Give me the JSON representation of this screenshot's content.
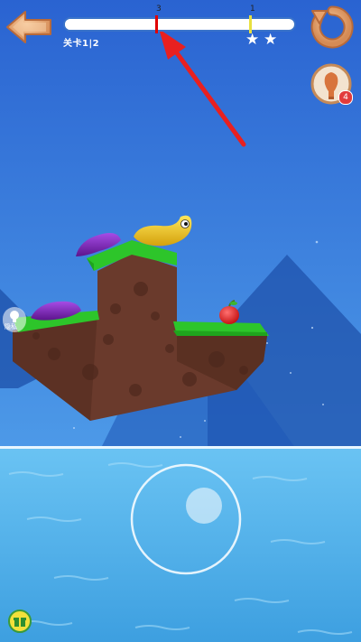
{
  "hud": {
    "back_button_icon": "left-arrow-icon",
    "restart_button_icon": "restart-icon",
    "progress": {
      "fraction": 0.4,
      "marker_three_stars_label": "3",
      "marker_one_star_label": "1",
      "marker_three_stars_color": "#e00000",
      "marker_one_star_color": "#e8e040"
    },
    "level_label": "关卡1|2",
    "stars": [
      "★",
      "★"
    ],
    "hint": {
      "icon": "lightbulb-hint-icon",
      "badge_count": "4",
      "badge_color": "#e23b3b"
    },
    "side_tab": {
      "icon": "hint-pointer-icon",
      "label": "隐私"
    },
    "bottom_left_icon": "gift-box-icon"
  },
  "annotation": {
    "arrow_color": "#e82020"
  },
  "colors": {
    "sky_top": "#2a63d1",
    "sky_bottom": "#4d9ae8",
    "water": "#58b4ea",
    "grass": "#2dc52a",
    "dirt": "#6a3a2c",
    "worm_purple": "#7a1fb5",
    "worm_yellow": "#f2cc1a",
    "apple": "#e21a1a"
  }
}
